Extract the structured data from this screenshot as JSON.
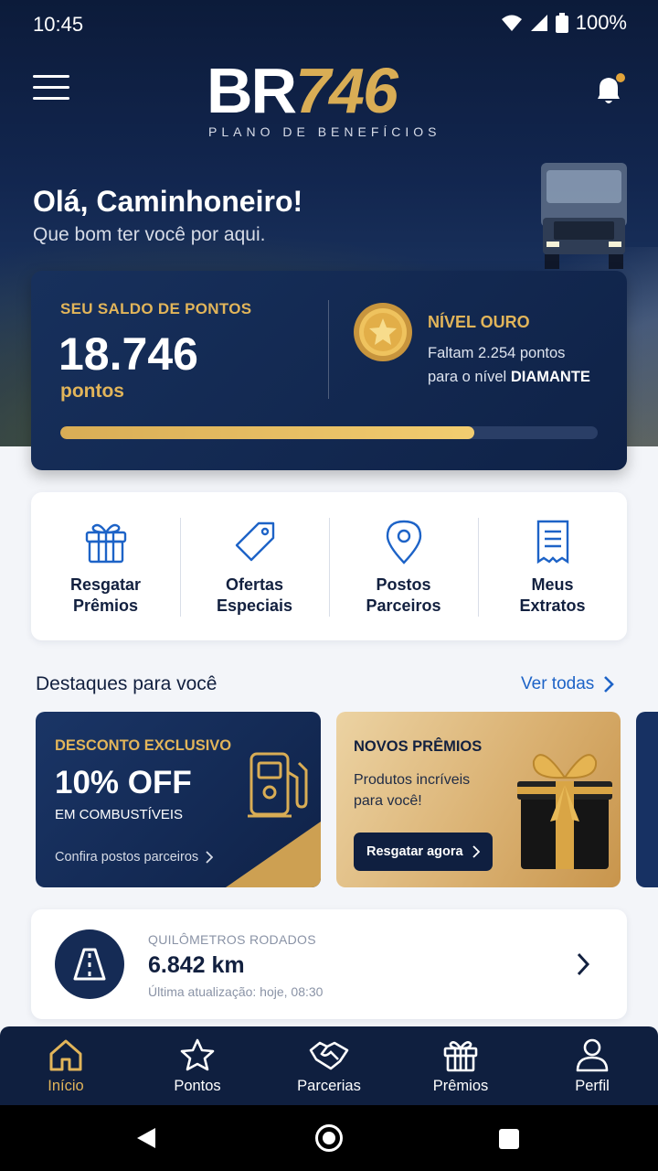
{
  "status_bar": {
    "time": "10:45",
    "battery": "100%"
  },
  "header": {
    "logo_main": "BR",
    "logo_number": "746",
    "logo_subtitle": "PLANO DE BENEFÍCIOS",
    "notification_badge_color": "#e2a43a"
  },
  "greeting": {
    "title": "Olá, Caminhoneiro!",
    "subtitle": "Que bom ter você por aqui."
  },
  "points": {
    "label": "SEU SALDO DE PONTOS",
    "value": "18.746",
    "unit": "pontos",
    "level": "NÍVEL OURO",
    "remaining_prefix": "Faltam 2.254 pontos",
    "remaining_line2": "para o nível",
    "next_level": "DIAMANTE",
    "progress_percent": 77
  },
  "shortcuts": [
    {
      "line1": "Resgatar",
      "line2": "Prêmios",
      "icon": "gift-icon"
    },
    {
      "line1": "Ofertas",
      "line2": "Especiais",
      "icon": "tag-icon"
    },
    {
      "line1": "Postos",
      "line2": "Parceiros",
      "icon": "map-pin-icon"
    },
    {
      "line1": "Meus",
      "line2": "Extratos",
      "icon": "receipt-icon"
    }
  ],
  "highlights": {
    "title": "Destaques para você",
    "see_all": "Ver todas",
    "promo1": {
      "tag": "DESCONTO EXCLUSIVO",
      "headline": "10% OFF",
      "sub": "EM COMBUSTÍVEIS",
      "link": "Confira postos parceiros"
    },
    "promo2": {
      "tag": "NOVOS PRÊMIOS",
      "sub_line1": "Produtos incríveis",
      "sub_line2": "para você!",
      "button": "Resgatar agora"
    }
  },
  "km": {
    "label": "QUILÔMETROS RODADOS",
    "value": "6.842 km",
    "updated": "Última atualização: hoje, 08:30"
  },
  "bottom_nav": [
    {
      "label": "Início",
      "icon": "home-icon",
      "active": true
    },
    {
      "label": "Pontos",
      "icon": "star-icon"
    },
    {
      "label": "Parcerias",
      "icon": "handshake-icon"
    },
    {
      "label": "Prêmios",
      "icon": "gift-icon"
    },
    {
      "label": "Perfil",
      "icon": "user-icon"
    }
  ],
  "colors": {
    "navy": "#0f1f3f",
    "gold": "#e2b55a",
    "link_blue": "#1d63c7"
  }
}
